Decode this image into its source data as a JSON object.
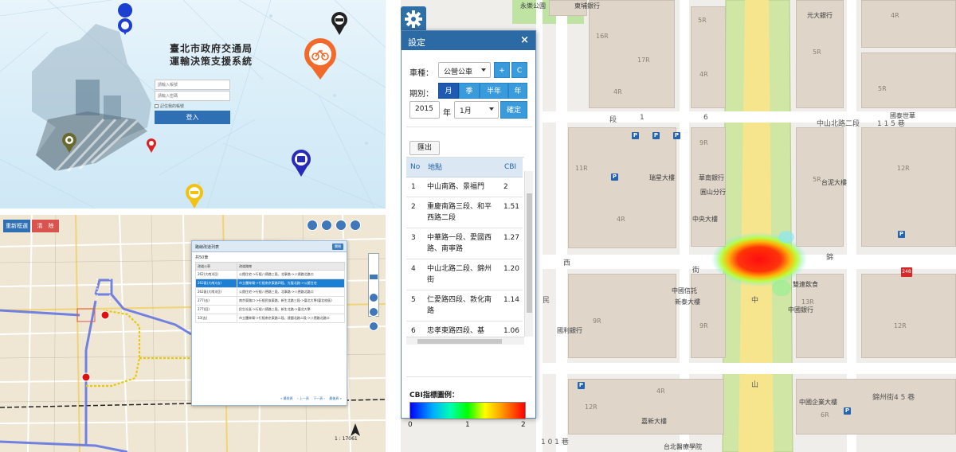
{
  "login": {
    "title_line1": "臺北市政府交通局",
    "title_line2": "運輸決策支援系統",
    "username_placeholder": "請輸入帳號",
    "password_placeholder": "請輸入密碼",
    "remember_label": "記住我的帳號",
    "login_button": "登入"
  },
  "route_panel": {
    "buttons": {
      "reselect": "重新框選",
      "clear": "清　除"
    },
    "dialog": {
      "title": "路線改道列表",
      "close": "關閉",
      "count": "共50筆",
      "columns": [
        "改道公車",
        "改道路線"
      ],
      "rows": [
        {
          "bus": "262(大南)(回)",
          "route": "公館住宅->行經八德路三段、北寧路->八德路北路口"
        },
        {
          "bus": "262區(大南)(去)",
          "route": "市立體育場->行經南京東路四段、光復北路->公館住宅"
        },
        {
          "bus": "262區(大南)(回)",
          "route": "公館住宅->行經八德路三段、北寧路->八德路北路口"
        },
        {
          "bus": "277(去)",
          "route": "南京東路口->行經民族東路、新生北路三段->臺北大學(臺北校區)"
        },
        {
          "bus": "277(回)",
          "route": "民生社區->行經八德路三段、新生北路->臺北大學"
        },
        {
          "bus": "33(去)",
          "route": "市立體育場->行經南京東路二段、建國北路二段->八德路北路口"
        }
      ],
      "pager": [
        "« 最前頁",
        "‹ 上一頁",
        "下一頁 ›",
        "最後頁 »"
      ]
    },
    "scale": "1 : 17061"
  },
  "settings": {
    "title": "設定",
    "close": "×",
    "vehicle_label": "車種：",
    "vehicle_value": "公營公車",
    "btn_plus": "+",
    "btn_c": "C",
    "period_label": "期別：",
    "periods": [
      "月",
      "季",
      "半年",
      "年"
    ],
    "active_period": "月",
    "year_value": "2015",
    "year_label": "年",
    "month_value": "1月",
    "confirm": "確定",
    "export": "匯出",
    "table": {
      "columns": [
        "No",
        "地點",
        "CBI"
      ],
      "rows": [
        {
          "no": "1",
          "place": "中山南路、景福門",
          "cbi": "2"
        },
        {
          "no": "2",
          "place": "重慶南路三段、和平西路二段",
          "cbi": "1.51"
        },
        {
          "no": "3",
          "place": "中華路一段、愛國西路、南寧路",
          "cbi": "1.27"
        },
        {
          "no": "4",
          "place": "中山北路二段、錦州街",
          "cbi": "1.20"
        },
        {
          "no": "5",
          "place": "仁愛路四段、敦化南路",
          "cbi": "1.14"
        },
        {
          "no": "6",
          "place": "忠孝東路四段、基",
          "cbi": "1.06"
        }
      ]
    },
    "legend_title": "CBI指標圖例：",
    "legend_ticks": [
      "0",
      "1",
      "2"
    ]
  },
  "map": {
    "labels": {
      "yongle": "永樂公園",
      "dongpu": "東埔銀行",
      "yuanda": "元大銀行",
      "zhongshan_n2_top": "中山北路二段",
      "n115": "1 1 5 巷",
      "guotai": "國泰世華",
      "duan1": "段",
      "alley1": "1",
      "alley6": "6",
      "ruixing": "瑞星大樓",
      "huanan": "華南銀行",
      "yuanshan": "圓山分行",
      "taini": "台泥大樓",
      "zhongyang": "中央大樓",
      "xi": "西",
      "jie": "街",
      "jin": "錦",
      "zhongguo_xintuo": "中國信託",
      "xinzhou": "新泰大樓",
      "shuangzhou": "雙連飲食",
      "zhongguo_yinhang": "中國銀行",
      "guolizhu": "國利銀行",
      "min": "民",
      "zhongshan_road_v": "中",
      "shan": "山",
      "zhongguo_qiye": "中國企業大樓",
      "jinzhou4": "錦州街4 5 巷",
      "xinqiao": "嘉新大樓",
      "taibei_hospital": "台北醫療學院",
      "lane101": "1 0 1 巷",
      "marker248": "248"
    }
  },
  "colors": {
    "header_blue": "#2c6aa6",
    "button_blue": "#3a9bdc",
    "active_blue": "#1f59b0",
    "road_green": "#cfe6a4",
    "road_yellow": "#f6e58d",
    "block_tan": "#dfd5c9",
    "selected_row": "#1b7fd4",
    "reselect_button": "#2f6fb4",
    "clear_button": "#d9534f"
  },
  "icons": [
    "gear-icon",
    "close-icon",
    "chevron-down-icon",
    "bicycle-pin-icon",
    "bus-pin-icon",
    "car-pin-icon",
    "taxi-pin-icon",
    "parking-icon",
    "north-arrow-icon"
  ]
}
